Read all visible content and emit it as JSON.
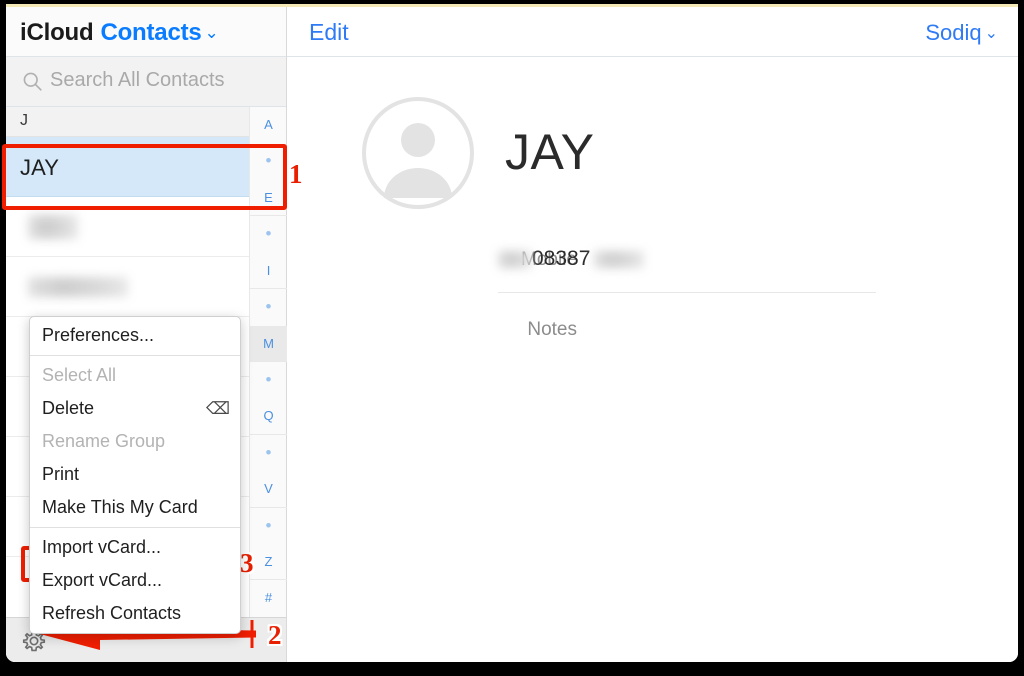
{
  "window": {
    "brand_primary": "iCloud",
    "brand_app": "Contacts",
    "brand_chevron": "⌄"
  },
  "accent_colors": {
    "link_blue": "#0a7cff",
    "selection_blue": "#d5e8f9",
    "annotation_red": "#f01e00"
  },
  "search": {
    "placeholder": "Search All Contacts",
    "icon": "search-icon"
  },
  "sidebar": {
    "section_header": "J",
    "contacts": [
      {
        "name": "JAY",
        "selected": true,
        "redacted": false
      },
      {
        "name": "",
        "selected": false,
        "redacted": true
      },
      {
        "name": "",
        "selected": false,
        "redacted": true
      }
    ],
    "alpha_index": [
      "A",
      "•",
      "E",
      "•",
      "I",
      "•",
      "M",
      "•",
      "Q",
      "•",
      "V",
      "•",
      "Z",
      "#"
    ],
    "toolbar": {
      "settings_icon": "gear-icon"
    }
  },
  "main": {
    "header": {
      "edit_label": "Edit",
      "account_label": "Sodiq",
      "account_chevron": "⌄"
    },
    "avatar_icon": "person-placeholder-icon",
    "contact_name": "JAY",
    "fields": [
      {
        "label": "Mobile",
        "value": "08387",
        "redacted": true
      },
      {
        "label": "Notes",
        "value": "",
        "redacted": false
      }
    ]
  },
  "context_menu": {
    "items": [
      {
        "label": "Preferences...",
        "disabled": false,
        "shortcut": "",
        "separator_after": true
      },
      {
        "label": "Select All",
        "disabled": true,
        "shortcut": ""
      },
      {
        "label": "Delete",
        "disabled": false,
        "shortcut": "⌫"
      },
      {
        "label": "Rename Group",
        "disabled": true,
        "shortcut": ""
      },
      {
        "label": "Print",
        "disabled": false,
        "shortcut": ""
      },
      {
        "label": "Make This My Card",
        "disabled": false,
        "shortcut": "",
        "separator_after": true
      },
      {
        "label": "Import vCard...",
        "disabled": false,
        "shortcut": ""
      },
      {
        "label": "Export vCard...",
        "disabled": false,
        "shortcut": "",
        "highlighted": true
      },
      {
        "label": "Refresh Contacts",
        "disabled": false,
        "shortcut": ""
      }
    ]
  },
  "annotations": {
    "steps": [
      {
        "number": "1",
        "target": "selected-contact-row"
      },
      {
        "number": "2",
        "target": "gear-settings-button"
      },
      {
        "number": "3",
        "target": "export-vcard-menu-item"
      }
    ]
  }
}
